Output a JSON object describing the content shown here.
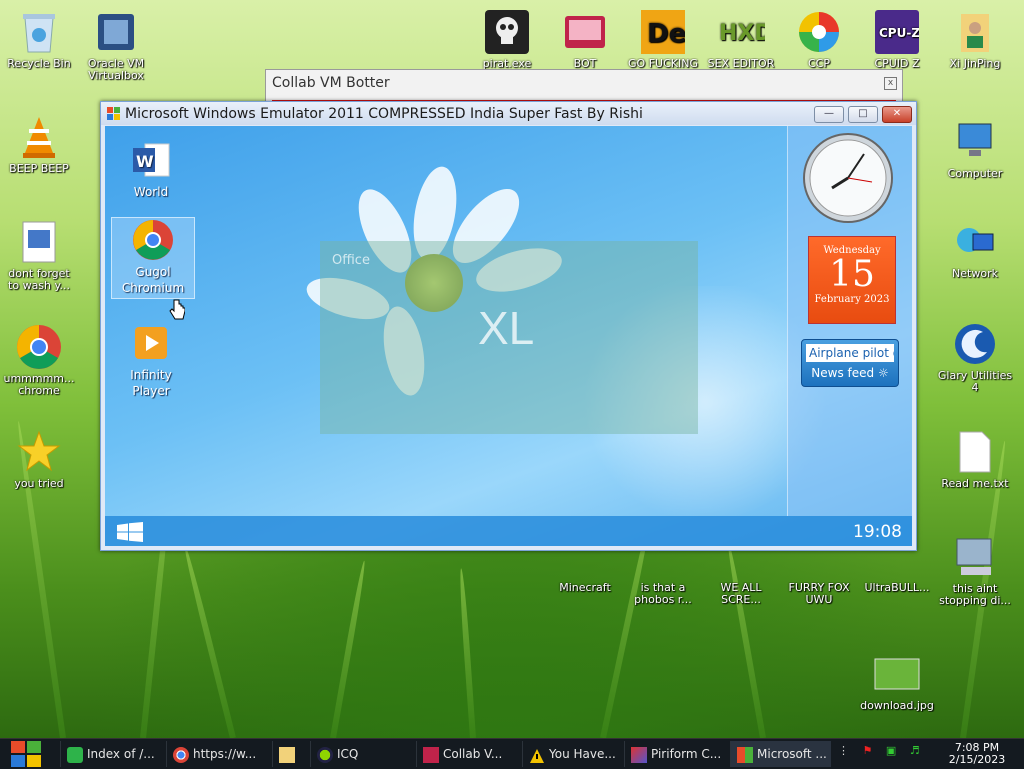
{
  "desktop": {
    "icons": [
      {
        "label": "Recycle Bin"
      },
      {
        "label": "Oracle VM Virtualbox"
      },
      {
        "label": "pirat.exe"
      },
      {
        "label": "BOT"
      },
      {
        "label": "GO FUCKING"
      },
      {
        "label": "SEX EDITOR"
      },
      {
        "label": "CCP"
      },
      {
        "label": "CPUID Z"
      },
      {
        "label": "Xi JinPing"
      },
      {
        "label": "BEEP BEEP"
      },
      {
        "label": "dont forget to wash y..."
      },
      {
        "label": "ummmmm... chrome"
      },
      {
        "label": "you tried"
      },
      {
        "label": "Computer"
      },
      {
        "label": "Network"
      },
      {
        "label": "Glary Utilities 4"
      },
      {
        "label": "Read me.txt"
      },
      {
        "label": "this aint stopping di..."
      },
      {
        "label": "Minecraft"
      },
      {
        "label": "is that a phobos r..."
      },
      {
        "label": "WE ALL SCRE..."
      },
      {
        "label": "FURRY FOX UWU"
      },
      {
        "label": "UltraBULL..."
      },
      {
        "label": "download.jpg"
      }
    ]
  },
  "botter": {
    "title": "Collab VM Botter",
    "close": "x"
  },
  "emulator": {
    "title": "Microsoft Windows Emulator 2011 COMPRESSED India Super Fast By Rishi",
    "icons": [
      {
        "label": "World"
      },
      {
        "label": "Gugol Chromium"
      },
      {
        "label": "Infinity Player"
      }
    ],
    "office_label": "Office",
    "office_app": "XL",
    "calendar": {
      "weekday": "Wednesday",
      "day": "15",
      "month_year": "February 2023"
    },
    "news": {
      "input": "Airplane pilot g",
      "label": "News feed"
    },
    "clock": "19:08"
  },
  "taskbar": {
    "items": [
      {
        "label": "Index of /..."
      },
      {
        "label": "https://w..."
      },
      {
        "label": ""
      },
      {
        "label": "ICQ"
      },
      {
        "label": "Collab V..."
      },
      {
        "label": "You Have..."
      },
      {
        "label": "Piriform C..."
      },
      {
        "label": "Microsoft ..."
      }
    ],
    "time": "7:08 PM",
    "date": "2/15/2023"
  },
  "colors": {
    "accent": "#1d72be",
    "calendar": "#e84c10",
    "alert_bar": "#e01010"
  }
}
